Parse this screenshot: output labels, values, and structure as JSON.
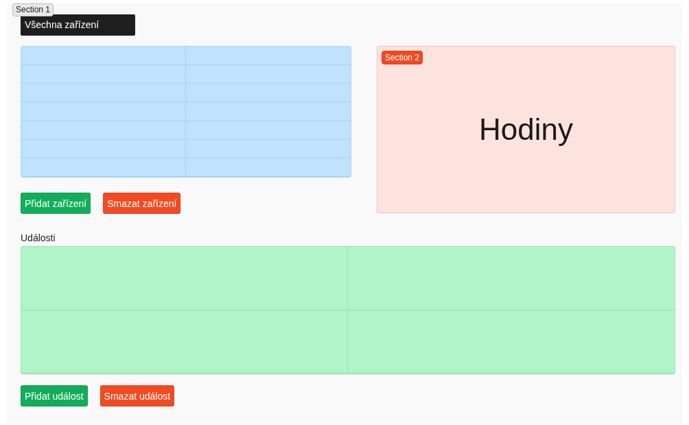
{
  "section_1": {
    "badge": "Section 1",
    "header_button": "Všechna zařízení",
    "devices_buttons": [
      {
        "label": "Přidat zařízení",
        "kind": "add"
      },
      {
        "label": "Smazat zařízení",
        "kind": "delete"
      }
    ]
  },
  "section_2": {
    "badge": "Section 2",
    "title": "Hodiny"
  },
  "events": {
    "heading": "Události",
    "buttons": [
      {
        "label": "Přidat událost",
        "kind": "add"
      },
      {
        "label": "Smazat událost",
        "kind": "delete"
      }
    ]
  }
}
